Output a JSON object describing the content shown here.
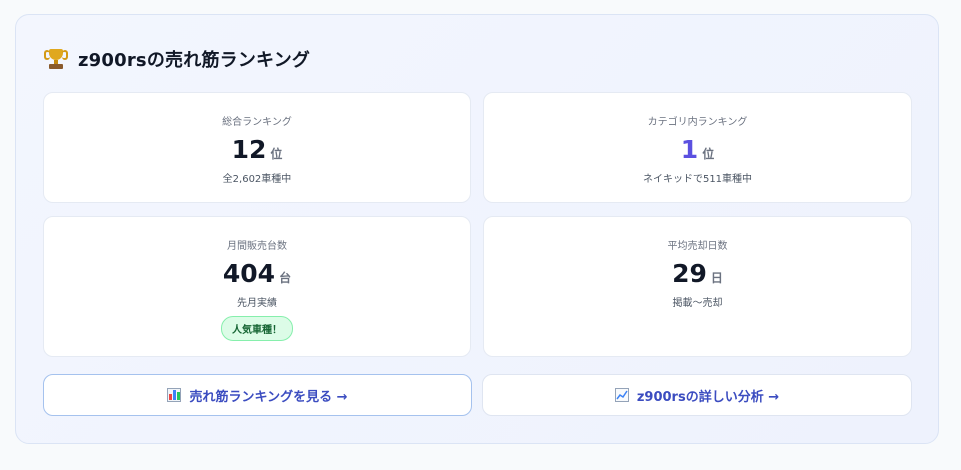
{
  "header": {
    "icon": "trophy-icon",
    "title": "z900rsの売れ筋ランキング"
  },
  "cards": {
    "overall": {
      "label": "総合ランキング",
      "value": "12",
      "unit": "位",
      "sub": "全2,602車種中"
    },
    "category": {
      "label": "カテゴリ内ランキング",
      "value": "1",
      "unit": "位",
      "sub": "ネイキッドで511車種中"
    },
    "monthly": {
      "label": "月間販売台数",
      "value": "404",
      "unit": "台",
      "sub": "先月実績",
      "badge": "人気車種！"
    },
    "days": {
      "label": "平均売却日数",
      "value": "29",
      "unit": "日",
      "sub": "掲載〜売却"
    }
  },
  "buttons": {
    "ranking": {
      "icon": "bar-chart-icon",
      "label": "売れ筋ランキングを見る →"
    },
    "analysis": {
      "icon": "line-chart-icon",
      "label": "z900rsの詳しい分析 →"
    }
  },
  "colors": {
    "accent": "#5b50e0",
    "badge_bg": "#dcfce7",
    "badge_text": "#166534",
    "link": "#3b4cc0"
  }
}
